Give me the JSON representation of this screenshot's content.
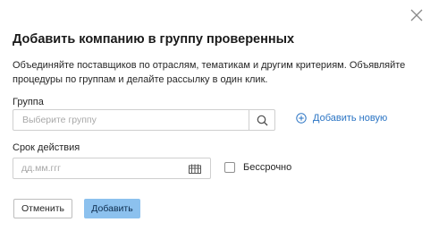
{
  "dialog": {
    "title": "Добавить компанию в группу проверенных",
    "description": "Объединяйте поставщиков по отраслям, тематикам и другим критериям. Объявляйте процедуры по группам и делайте рассылку в один клик."
  },
  "group": {
    "label": "Группа",
    "placeholder": "Выберите группу",
    "value": "",
    "add_new_label": "Добавить новую"
  },
  "validity": {
    "label": "Срок действия",
    "placeholder": "дд.мм.ггг",
    "value": "",
    "forever_label": "Бессрочно",
    "forever_checked": false
  },
  "buttons": {
    "cancel_label": "Отменить",
    "add_label": "Добавить"
  },
  "icons": {
    "close": "close-icon",
    "search": "search-icon",
    "add": "plus-circle-icon",
    "calendar": "calendar-icon"
  },
  "colors": {
    "accent": "#2a74c4",
    "primary_button": "#8cc1ee",
    "border": "#cfcfcf"
  }
}
